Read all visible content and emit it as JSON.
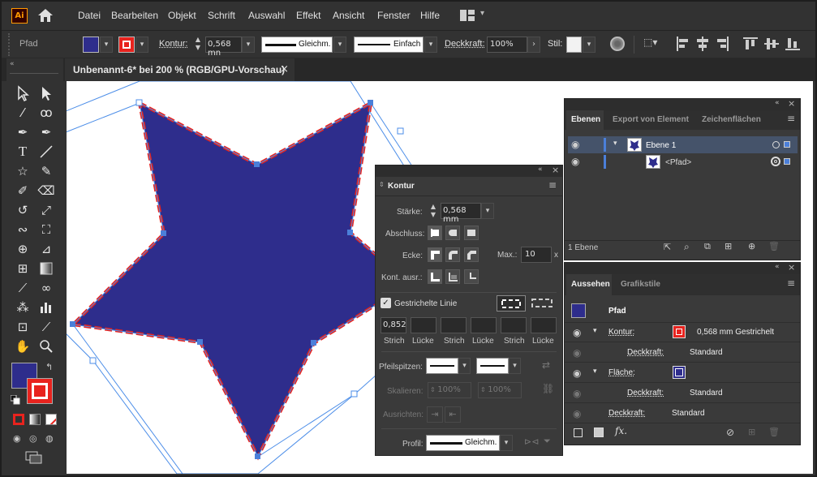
{
  "app": {
    "logo": "Ai"
  },
  "menu": [
    "Datei",
    "Bearbeiten",
    "Objekt",
    "Schrift",
    "Auswahl",
    "Effekt",
    "Ansicht",
    "Fenster",
    "Hilfe"
  ],
  "control_bar": {
    "object_type": "Pfad",
    "stroke_label": "Kontur:",
    "stroke_weight": "0,568 mn",
    "profile_label": "Gleichm.",
    "brush_label": "Einfach",
    "opacity_label": "Deckkraft:",
    "opacity_value": "100%",
    "style_label": "Stil:"
  },
  "document": {
    "tab_title": "Unbenannt-6* bei 200 % (RGB/GPU-Vorschau)",
    "close": "×"
  },
  "colors": {
    "fill": "#2e2d8c",
    "stroke": "#e8231e",
    "accent": "#4b7fd9",
    "path_blue": "#4b8de8"
  },
  "kontur_panel": {
    "title": "Kontur",
    "staerke_label": "Stärke:",
    "staerke_value": "0,568 mm",
    "abschluss_label": "Abschluss:",
    "ecke_label": "Ecke:",
    "max_label": "Max.:",
    "max_value": "10",
    "max_unit": "x",
    "kont_label": "Kont. ausr.:",
    "dashed_label": "Gestrichelte Linie",
    "dash_values": [
      "0,852",
      "",
      "",
      "",
      "",
      ""
    ],
    "dash_labels": [
      "Strich",
      "Lücke",
      "Strich",
      "Lücke",
      "Strich",
      "Lücke"
    ],
    "pfeil_label": "Pfeilspitzen:",
    "skalieren_label": "Skalieren:",
    "skalieren_values": [
      "100%",
      "100%"
    ],
    "ausrichten_label": "Ausrichten:",
    "profil_label": "Profil:",
    "profil_value": "Gleichm."
  },
  "ebenen_panel": {
    "tabs": [
      "Ebenen",
      "Export von Element",
      "Zeichenflächen"
    ],
    "layers": [
      {
        "name": "Ebene 1"
      },
      {
        "name": "<Pfad>"
      }
    ],
    "footer": "1 Ebene"
  },
  "aussehen_panel": {
    "tabs": [
      "Aussehen",
      "Grafikstile"
    ],
    "object": "Pfad",
    "rows": [
      {
        "label": "Kontur:",
        "value": "0,568 mm Gestrichelt"
      },
      {
        "label": "Deckkraft:",
        "value": "Standard"
      },
      {
        "label": "Fläche:",
        "value": ""
      },
      {
        "label": "Deckkraft:",
        "value": "Standard"
      },
      {
        "label": "Deckkraft:",
        "value": "Standard"
      }
    ],
    "fx_label": "fx."
  }
}
